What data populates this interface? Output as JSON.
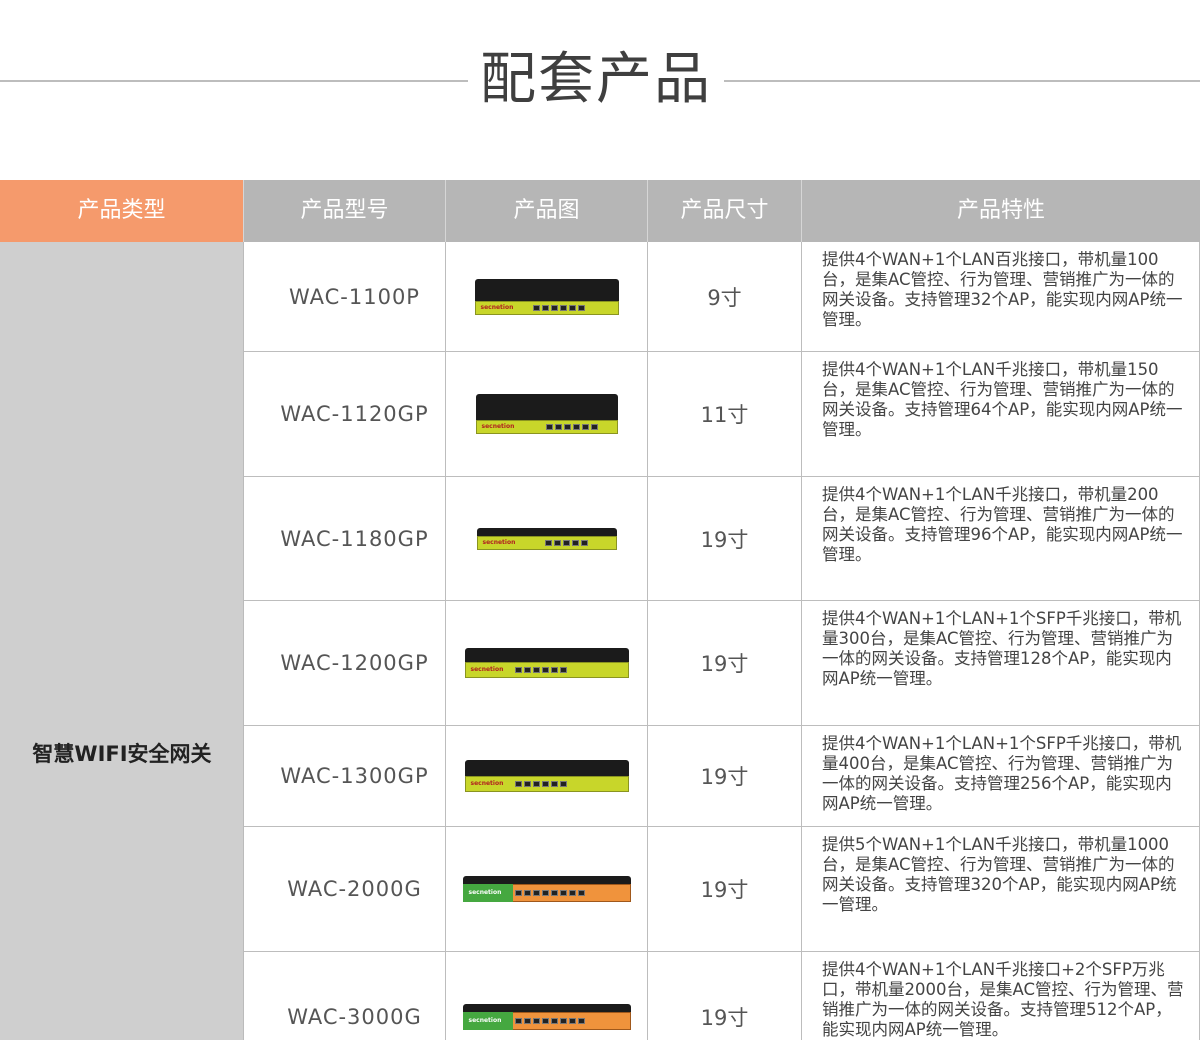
{
  "page": {
    "title": "配套产品"
  },
  "table": {
    "headers": {
      "type": "产品类型",
      "model": "产品型号",
      "image": "产品图",
      "size": "产品尺寸",
      "features": "产品特性"
    },
    "category": "智慧WIFI安全网关",
    "brand_label": "secnetion",
    "rows": [
      {
        "model": "WAC-1100P",
        "size": "9寸",
        "features": "提供4个WAN+1个LAN百兆接口，带机量100台，是集AC管控、行为管理、营销推广为一体的网关设备。支持管理32个AP，能实现内网AP统一管理。",
        "icon": "router-device-icon"
      },
      {
        "model": "WAC-1120GP",
        "size": "11寸",
        "features": "提供4个WAN+1个LAN千兆接口，带机量150台，是集AC管控、行为管理、营销推广为一体的网关设备。支持管理64个AP，能实现内网AP统一管理。",
        "icon": "router-device-icon"
      },
      {
        "model": "WAC-1180GP",
        "size": "19寸",
        "features": "提供4个WAN+1个LAN千兆接口，带机量200台，是集AC管控、行为管理、营销推广为一体的网关设备。支持管理96个AP，能实现内网AP统一管理。",
        "icon": "router-device-icon"
      },
      {
        "model": "WAC-1200GP",
        "size": "19寸",
        "features": "提供4个WAN+1个LAN+1个SFP千兆接口，带机量300台，是集AC管控、行为管理、营销推广为一体的网关设备。支持管理128个AP，能实现内网AP统一管理。",
        "icon": "router-device-icon"
      },
      {
        "model": "WAC-1300GP",
        "size": "19寸",
        "features": "提供4个WAN+1个LAN+1个SFP千兆接口，带机量400台，是集AC管控、行为管理、营销推广为一体的网关设备。支持管理256个AP，能实现内网AP统一管理。",
        "icon": "router-device-icon"
      },
      {
        "model": "WAC-2000G",
        "size": "19寸",
        "features": "提供5个WAN+1个LAN千兆接口，带机量1000台，是集AC管控、行为管理、营销推广为一体的网关设备。支持管理320个AP，能实现内网AP统一管理。",
        "icon": "router-device-icon"
      },
      {
        "model": "WAC-3000G",
        "size": "19寸",
        "features": "提供4个WAN+1个LAN千兆接口+2个SFP万兆口，带机量2000台，是集AC管控、行为管理、营销推广为一体的网关设备。支持管理512个AP，能实现内网AP统一管理。",
        "icon": "router-device-icon"
      }
    ]
  },
  "colors": {
    "header_gray": "#b6b6b6",
    "header_accent": "#f59a6c",
    "category_bg": "#cfcfcf"
  }
}
